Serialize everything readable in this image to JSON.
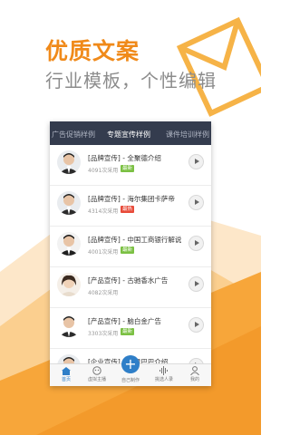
{
  "hero": {
    "title": "优质文案",
    "subtitle": "行业模板，个性编辑"
  },
  "tabs": [
    {
      "label": "广告促销样例",
      "active": false
    },
    {
      "label": "专题宣传样例",
      "active": true
    },
    {
      "label": "课件培训样例",
      "active": false
    }
  ],
  "items": [
    {
      "title": "[品牌宣传] - 全聚德介绍",
      "count": "4091次采用",
      "badge": "最新",
      "badge_color": "#7bc043"
    },
    {
      "title": "[品牌宣传] - 海尔集团卡萨帝",
      "count": "4314次采用",
      "badge": "最热",
      "badge_color": "#e84b3a"
    },
    {
      "title": "[品牌宣传] - 中国工商银行解说",
      "count": "4001次采用",
      "badge": "最新",
      "badge_color": "#7bc043"
    },
    {
      "title": "[产品宣传] - 古驰香水广告",
      "count": "4082次采用",
      "badge": "",
      "badge_color": ""
    },
    {
      "title": "[产品宣传] - 脑白金广告",
      "count": "3303次采用",
      "badge": "最新",
      "badge_color": "#7bc043"
    },
    {
      "title": "[企业宣传] - 阿里巴巴介绍",
      "count": "",
      "badge": "",
      "badge_color": ""
    }
  ],
  "bottom_nav": [
    {
      "label": "首页",
      "icon": "home-icon",
      "active": true
    },
    {
      "label": "虚拟主播",
      "icon": "anchor-icon",
      "active": false
    },
    {
      "label": "自己制作",
      "icon": "plus-icon",
      "active": false
    },
    {
      "label": "挑选人录",
      "icon": "audio-icon",
      "active": false
    },
    {
      "label": "我的",
      "icon": "user-icon",
      "active": false
    }
  ],
  "colors": {
    "accent": "#f08a1a",
    "tab_bg": "#343c4e",
    "nav_active": "#2f7fc8"
  }
}
